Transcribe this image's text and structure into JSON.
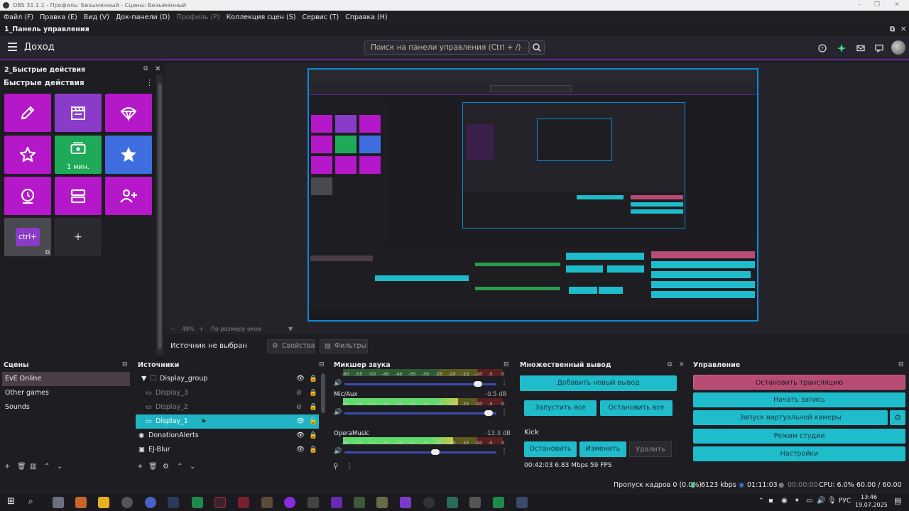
{
  "window": {
    "title": "OBS 31.1.1 - Профиль: Безымянный - Сцены: Безымянный"
  },
  "menu": [
    {
      "label": "Файл (F)",
      "enabled": true
    },
    {
      "label": "Правка (E)",
      "enabled": true
    },
    {
      "label": "Вид (V)",
      "enabled": true
    },
    {
      "label": "Док-панели (D)",
      "enabled": true
    },
    {
      "label": "Профиль (P)",
      "enabled": false
    },
    {
      "label": "Коллекция сцен (S)",
      "enabled": true
    },
    {
      "label": "Сервис (T)",
      "enabled": true
    },
    {
      "label": "Справка (H)",
      "enabled": true
    }
  ],
  "dashboard_dock": {
    "title": "1_Панель управления"
  },
  "dashboard": {
    "title": "Доход",
    "search_placeholder": "Поиск на панели управления (Ctrl + /)",
    "icons": [
      "help-icon",
      "sparkle-icon",
      "mail-icon",
      "chat-icon",
      "avatar"
    ]
  },
  "quick_actions": {
    "dock_title": "2_Быстрые действия",
    "title": "Быстрые действия",
    "tiles": [
      {
        "icon": "pencil-icon",
        "color": "#b418c8",
        "label": ""
      },
      {
        "icon": "clapperboard-icon",
        "color": "#8b3bc9",
        "label": ""
      },
      {
        "icon": "parachute-icon",
        "color": "#b418c8",
        "label": ""
      },
      {
        "icon": "star-outline-icon",
        "color": "#b418c8",
        "label": ""
      },
      {
        "icon": "cash-icon",
        "color": "#1faa5a",
        "label": "1 мин."
      },
      {
        "icon": "star-filled-icon",
        "color": "#3f6ee0",
        "label": ""
      },
      {
        "icon": "timer-icon",
        "color": "#b418c8",
        "label": ""
      },
      {
        "icon": "layers-icon",
        "color": "#b418c8",
        "label": ""
      },
      {
        "icon": "add-user-icon",
        "color": "#b418c8",
        "label": ""
      },
      {
        "icon": "ctrl-badge",
        "color": "#4a4950",
        "label": "ctrl+"
      },
      {
        "icon": "plus-icon",
        "color": "#2a2a30",
        "label": "+"
      }
    ]
  },
  "preview": {
    "zoom": "49%",
    "fit_label": "По размеру окна",
    "no_source": "Источник не выбран",
    "properties_btn": "Свойства",
    "filters_btn": "Фильтры"
  },
  "scenes": {
    "title": "Сцены",
    "items": [
      "EvE Online",
      "Other games",
      "Sounds"
    ],
    "selected": 0
  },
  "sources": {
    "title": "Источники",
    "items": [
      {
        "name": "Display_group",
        "type": "group",
        "visible": true,
        "locked": true,
        "indent": 0
      },
      {
        "name": "Display_3",
        "type": "display",
        "visible": false,
        "locked": true,
        "indent": 1
      },
      {
        "name": "Display_2",
        "type": "display",
        "visible": false,
        "locked": true,
        "indent": 1
      },
      {
        "name": "Display_1",
        "type": "display",
        "visible": true,
        "locked": false,
        "indent": 1,
        "selected": true
      },
      {
        "name": "DonationAlerts",
        "type": "browser",
        "visible": true,
        "locked": true,
        "indent": 0
      },
      {
        "name": "EJ-Blur",
        "type": "filter",
        "visible": true,
        "locked": true,
        "indent": 0
      }
    ]
  },
  "mixer": {
    "title": "Микшер звука",
    "ticks": [
      "-60",
      "-55",
      "-50",
      "-45",
      "-40",
      "-35",
      "-30",
      "-25",
      "-20",
      "-15",
      "-10",
      "-5",
      "0"
    ],
    "channels": [
      {
        "name": "",
        "db": "",
        "level": 0.0,
        "volume": 0.88
      },
      {
        "name": "Mic/Aux",
        "db": "-0.5 dB",
        "level": 0.72,
        "volume": 0.95
      },
      {
        "name": "OperaMusic",
        "db": "-13.3 dB",
        "level": 0.69,
        "volume": 0.6
      }
    ]
  },
  "multi_output": {
    "title": "Множественный вывод",
    "add_btn": "Добавить новый вывод",
    "start_all": "Запустить все",
    "stop_all": "Остановить все",
    "target": "Kick",
    "stop_btn": "Остановить",
    "edit_btn": "Изменить",
    "delete_btn": "Удалить",
    "stats": "00:42:03 6.83 Mbps 59 FPS"
  },
  "controls": {
    "title": "Управление",
    "stop_stream": "Остановить трансляцию",
    "start_record": "Начать запись",
    "virtual_cam": "Запуск виртуальной камеры",
    "studio_mode": "Режим студии",
    "settings": "Настройки"
  },
  "status": {
    "dropped": "Пропуск кадров 0 (0.0%)",
    "bitrate": "6123 kbps",
    "stream_time": "01:11:03",
    "record_time": "00:00:00",
    "cpu": "CPU: 6.0%",
    "fps": "60.00 / 60.00 FPS"
  },
  "taskbar": {
    "lang": "РУС",
    "time": "13:46",
    "date": "19.07.2025"
  },
  "colors": {
    "accent_teal": "#1fbccc",
    "accent_purple": "#b418c8",
    "stop_btn": "#b94c74"
  }
}
